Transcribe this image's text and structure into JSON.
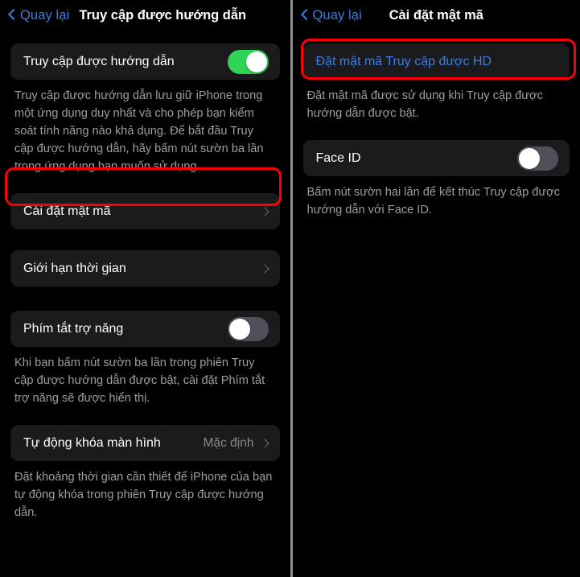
{
  "left_panel": {
    "nav": {
      "back_label": "Quay lại",
      "back_icon": "chevron-left-icon",
      "title": "Truy cập được hướng dẫn"
    },
    "guided_access": {
      "label": "Truy cập được hướng dẫn",
      "toggle_state": "on",
      "toggle_color": "#2fd355",
      "description": "Truy cập được hướng dẫn lưu giữ iPhone trong một ứng dụng duy nhất và cho phép bạn kiểm soát tính năng nào khả dụng. Để bắt đầu Truy cập được hướng dẫn, hãy bấm nút sườn ba lần trong ứng dụng bạn muốn sử dụng."
    },
    "passcode_settings": {
      "label": "Cài đặt mật mã",
      "chevron_icon": "chevron-right-icon",
      "highlighted": true,
      "highlight_color": "#fb0007"
    },
    "time_limits": {
      "label": "Giới hạn thời gian",
      "chevron_icon": "chevron-right-icon"
    },
    "accessibility_shortcut": {
      "label": "Phím tắt trợ năng",
      "toggle_state": "off",
      "toggle_color": "#50505a",
      "description": "Khi bạn bấm nút sườn ba lần trong phiên Truy cập được hướng dẫn được bật, cài đặt Phím tắt trợ năng sẽ được hiển thị."
    },
    "display_auto_lock": {
      "label": "Tự động khóa màn hình",
      "value": "Mặc định",
      "chevron_icon": "chevron-right-icon",
      "description": "Đặt khoảng thời gian cần thiết để iPhone của bạn tự động khóa trong phiên Truy cập được hướng dẫn."
    }
  },
  "right_panel": {
    "nav": {
      "back_label": "Quay lại",
      "back_icon": "chevron-left-icon",
      "title": "Cài đặt mật mã"
    },
    "set_passcode": {
      "label": "Đặt mật mã Truy cập được HD",
      "text_color": "#3b7de0",
      "highlighted": true,
      "highlight_color": "#fb0007",
      "description": "Đặt mật mã được sử dụng khi Truy cập được hướng dẫn được bật."
    },
    "face_id": {
      "label": "Face ID",
      "toggle_state": "off",
      "toggle_color": "#50505a",
      "description": "Bấm nút sườn hai lần để kết thúc Truy cập được hướng dẫn với Face ID."
    }
  }
}
